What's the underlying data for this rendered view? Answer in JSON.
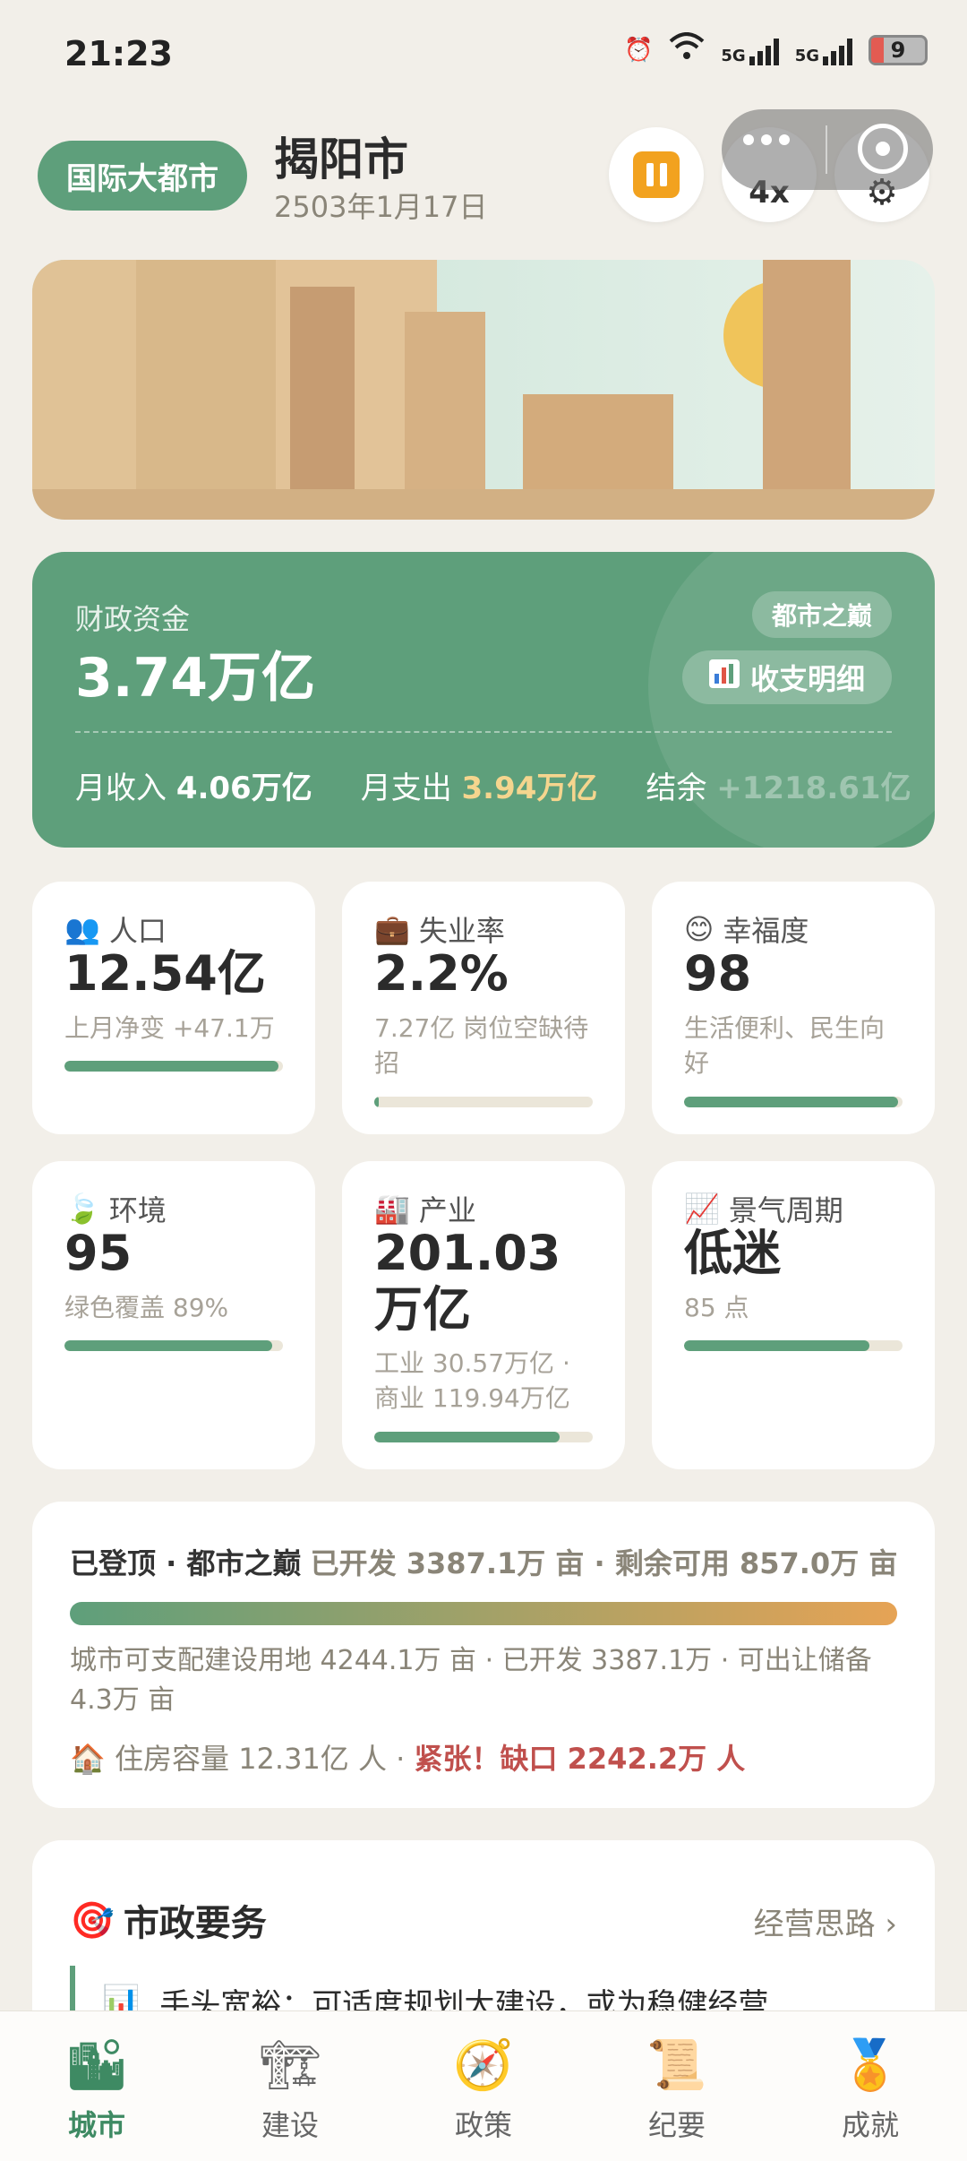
{
  "status_bar": {
    "time": "21:23",
    "network1": "5G",
    "network2": "5G",
    "battery": "9"
  },
  "header": {
    "rank_badge": "国际大都市",
    "city_name": "揭阳市",
    "date": "2503年1月17日",
    "speed": "4x"
  },
  "finance": {
    "label": "财政资金",
    "value": "3.74万亿",
    "badge": "都市之巅",
    "detail_button": "收支明细",
    "income_label": "月收入",
    "income_value": "4.06万亿",
    "expense_label": "月支出",
    "expense_value": "3.94万亿",
    "balance_label": "结余",
    "balance_value": "+1218.61亿"
  },
  "stats": [
    {
      "icon": "people-icon",
      "title": "人口",
      "value": "12.54亿",
      "sub": "上月净变 +47.1万",
      "progress": 0.98
    },
    {
      "icon": "briefcase-icon",
      "title": "失业率",
      "value": "2.2%",
      "sub": "7.27亿 岗位空缺待招",
      "progress": 0.02
    },
    {
      "icon": "smile-icon",
      "title": "幸福度",
      "value": "98",
      "sub": "生活便利、民生向好",
      "progress": 0.98
    },
    {
      "icon": "leaf-icon",
      "title": "环境",
      "value": "95",
      "sub": "绿色覆盖 89%",
      "progress": 0.95
    },
    {
      "icon": "factory-icon",
      "title": "产业",
      "value": "201.03万亿",
      "sub": "工业 30.57万亿 · 商业 119.94万亿",
      "progress": 0.85
    },
    {
      "icon": "chart-up-icon",
      "title": "景气周期",
      "value": "低迷",
      "sub": "85 点",
      "progress": 0.85
    }
  ],
  "land": {
    "title_bold": "已登顶 · 都市之巅",
    "title_rest": "已开发 3387.1万 亩 · 剩余可用 857.0万 亩",
    "description": "城市可支配建设用地 4244.1万 亩 · 已开发 3387.1万 · 可出让储备 4.3万 亩",
    "housing_text": "住房容量 12.31亿 人 · ",
    "housing_alert": "紧张！缺口 2242.2万 人"
  },
  "affairs": {
    "title": "市政要务",
    "link": "经营思路 ›",
    "item": "手头宽裕：可适度规划大建设，或为稳健经营"
  },
  "nav": [
    {
      "label": "城市",
      "icon": "city-icon"
    },
    {
      "label": "建设",
      "icon": "crane-icon"
    },
    {
      "label": "政策",
      "icon": "compass-icon"
    },
    {
      "label": "纪要",
      "icon": "scroll-icon"
    },
    {
      "label": "成就",
      "icon": "medal-icon"
    }
  ]
}
